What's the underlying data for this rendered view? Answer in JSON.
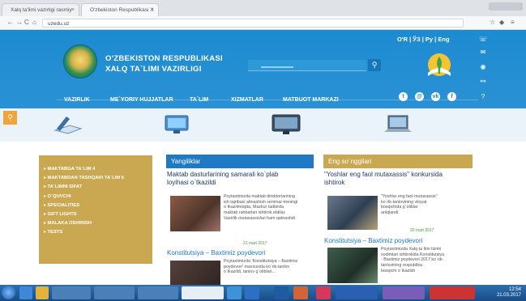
{
  "browser": {
    "tabs": [
      {
        "label": "Xalq ta'limi vazirligi rasmiy"
      },
      {
        "label": "O'zbekiston Respublikasi X"
      }
    ],
    "url": "uzedu.uz",
    "nav_back": "←",
    "nav_forward": "→",
    "nav_reload": "C",
    "nav_home": "⌂"
  },
  "header": {
    "title_line1": "O'ZBEKISTON RESPUBLIKASI",
    "title_line2": "XALQ TA`LIMI VAZIRLIGI",
    "languages": "O'R | ЎЗ | Ру | Eng",
    "search_icon": "search-icon",
    "nav": [
      "VAZIRLIK",
      "ME`YORIY HUJJATLAR",
      "TA`LIM",
      "XIZMATLAR",
      "MATBUOT MARKAZI"
    ],
    "social": [
      "t",
      "@",
      "vk",
      "f"
    ]
  },
  "strip": {
    "labels": [
      "",
      "",
      "",
      ""
    ]
  },
  "left_menu": {
    "items": [
      "MAKTABGA TA`LIM 4",
      "MAKTABDAN TASHQARI TA`LIM 5",
      "TA`LIMNI SIFAT",
      "O`QUVCHI",
      "SPECIALITIES",
      "GIFT LIGHTS",
      "MALAKA OSHIRISH",
      "TESTS"
    ]
  },
  "news_left": {
    "heading": "Yangiliklar",
    "headline1": "Maktab dasturlarining samarali ko`plab",
    "headline1_line2": "loyihasi o`tkazildi",
    "body1": [
      "Poytaxtimizda maktab direktorlarining",
      "ish tajribasi almashish seminar-treningi",
      "o`tkazilmoqda. Mazkur tadbirda",
      "maktab rahbarlari ishtirok etdilar,",
      "Vazirlik mutaxassislari ham qatnashdi"
    ],
    "meta1": "21 mart 2017",
    "headline2": "Konstitutsiya – Baxtimiz poydevori",
    "body2": [
      "Poytaxtimizda 'Konstitutsiya – Baxtimiz",
      "poydevori' mavzusida ko`rik-tanlov",
      "o`tkazildi, tanlov g`oliblari..."
    ]
  },
  "news_right": {
    "heading": "Eng so`nggilari",
    "headline1": "\"Yoshlar eng faol mutaxassis\" konkursida",
    "headline1_line2": "ishtirok",
    "body1": [
      "\"Yoshlar eng faol mutaxassis\"",
      "ko`rik-tanlovining viloyat",
      "bosqichida g`oliblar",
      "aniqlandi."
    ],
    "meta1": "20 mart 2017",
    "headline2": "Konstitutsiya – Baxtimiz poydevori",
    "body2": [
      "Poytaxtimizda Xalq ta`limi tizimi",
      "xodimlari ishtirokida Konstitutsiya",
      "- Baxtimiz poydevori 2017 ko`rik-",
      "tanlovining respublika",
      "bosqichi o`tkazildi"
    ]
  },
  "taskbar": {
    "clock_time": "12:54",
    "clock_date": "21.03.2017"
  },
  "colors": {
    "header_blue": "#1d8bd1",
    "gold": "#c9a851",
    "news_blue": "#1f79c4"
  }
}
